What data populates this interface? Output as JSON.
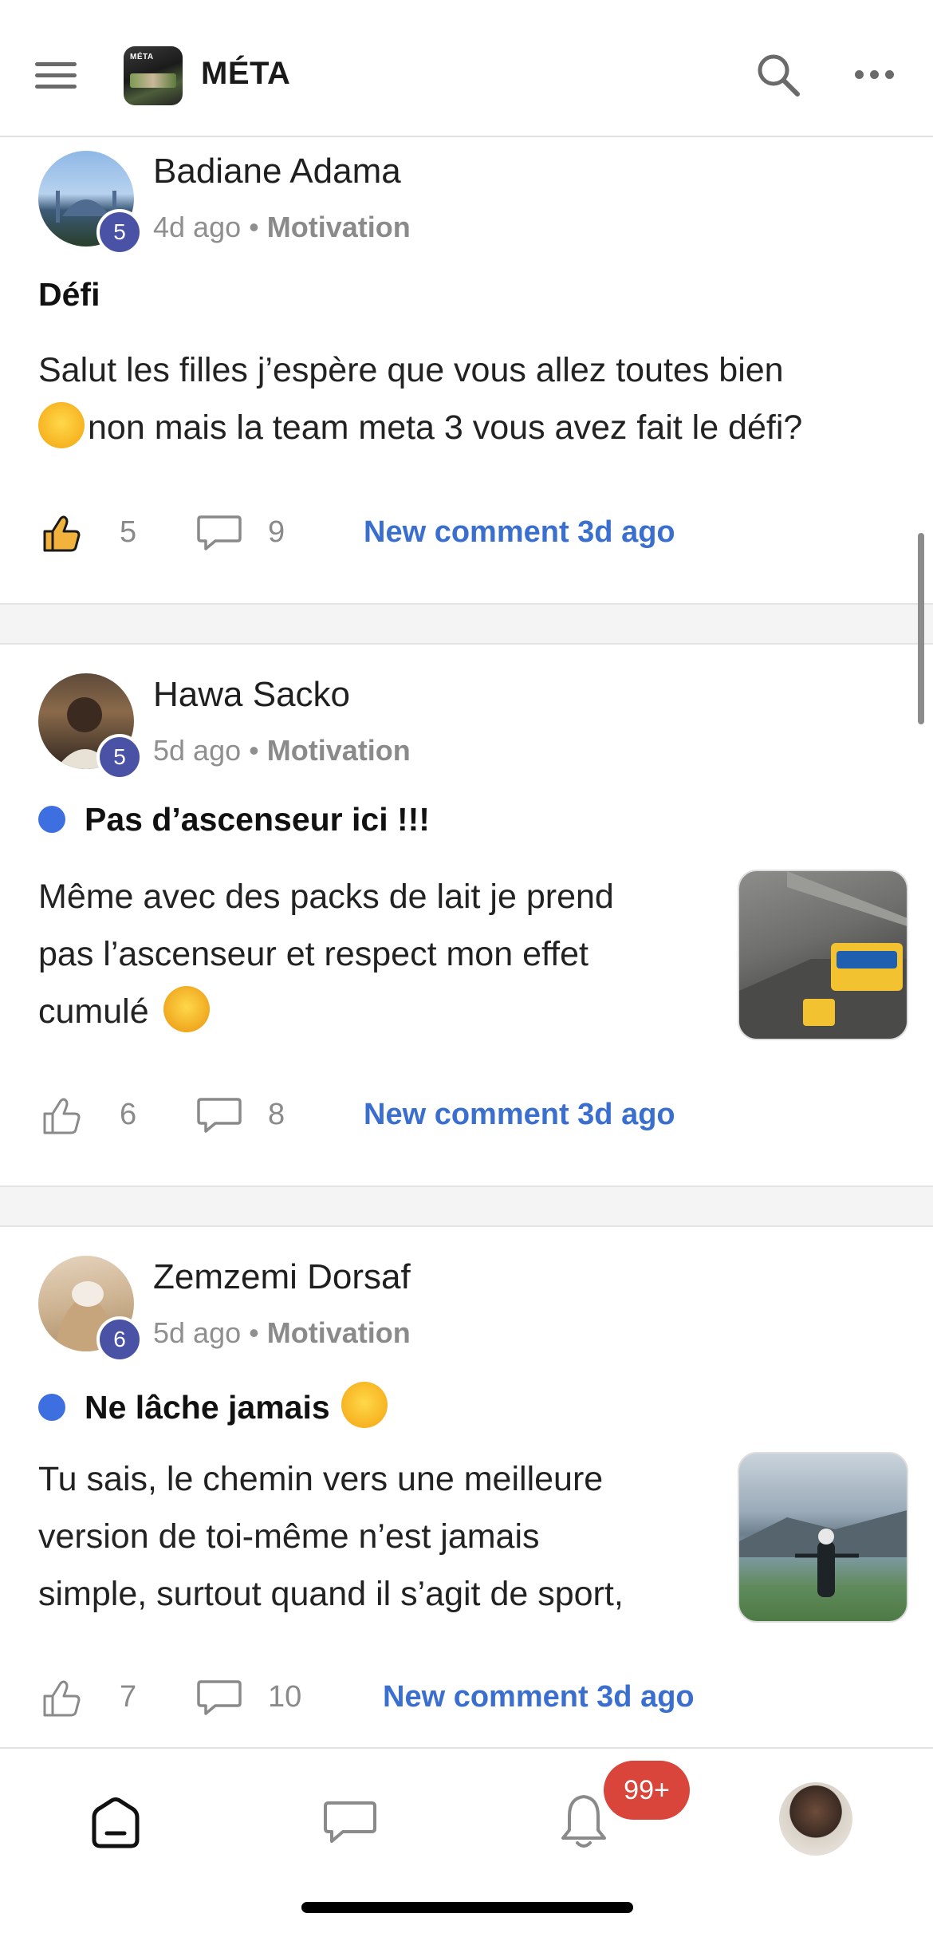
{
  "header": {
    "app_title": "MÉTA",
    "logo_text": "MÉTA"
  },
  "posts": [
    {
      "author": "Badiane Adama",
      "level": "5",
      "time": "4d ago",
      "separator": "•",
      "category": "Motivation",
      "title": "Défi",
      "unread": false,
      "body_line1": "Salut les filles j’espère que vous allez toutes bien",
      "body_line2": "non mais la team meta 3 vous avez fait le défi?",
      "emoji": "smiling-face-with-hearts",
      "likes": "5",
      "liked": true,
      "comments": "9",
      "new_comment": "New comment 3d ago"
    },
    {
      "author": "Hawa Sacko",
      "level": "5",
      "time": "5d ago",
      "separator": "•",
      "category": "Motivation",
      "title": "Pas d’ascenseur ici !!!",
      "unread": true,
      "body_line1": "Même avec des packs de lait je prend",
      "body_line2": "pas l’ascenseur et respect mon effet",
      "body_line3": "cumulé",
      "emoji": "face-with-hand-over-mouth",
      "likes": "6",
      "liked": false,
      "comments": "8",
      "new_comment": "New comment 3d ago"
    },
    {
      "author": "Zemzemi Dorsaf",
      "level": "6",
      "time": "5d ago",
      "separator": "•",
      "category": "Motivation",
      "title": "Ne lâche jamais",
      "unread": true,
      "body_line1": "Tu sais, le chemin vers une meilleure",
      "body_line2": "version de toi-même n’est jamais",
      "body_line3": "simple, surtout quand il s’agit de sport,",
      "emoji": "smiling-face-with-hearts",
      "likes": "7",
      "liked": false,
      "comments": "10",
      "new_comment": "New comment 3d ago"
    }
  ],
  "bottom_nav": {
    "notification_count": "99+"
  },
  "colors": {
    "accent_blue": "#3a6fd0",
    "unread_dot": "#3d6fe0",
    "level_badge": "#4a52a6",
    "notification_badge": "#d9453a",
    "like_active": "#f2b33d"
  }
}
